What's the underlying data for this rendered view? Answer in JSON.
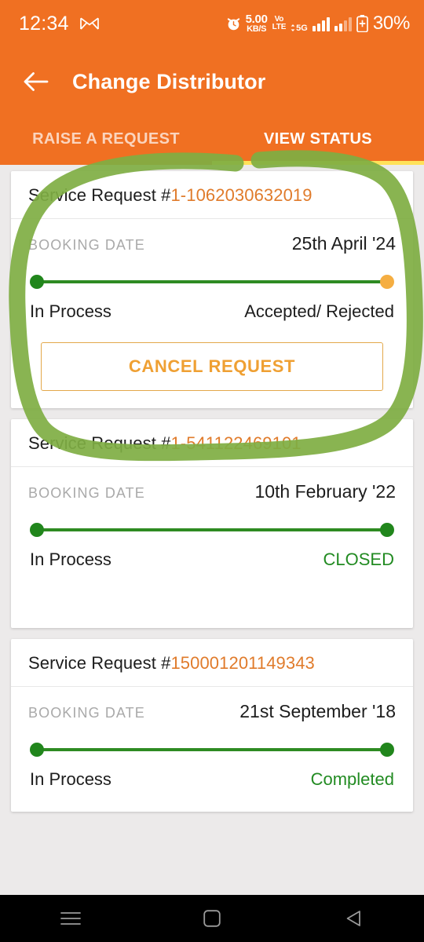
{
  "status_bar": {
    "time": "12:34",
    "gmail_icon": "gmail-icon",
    "alarm_icon": "alarm-icon",
    "net_speed_value": "5.00",
    "net_speed_unit": "KB/S",
    "volte_line1": "Vo",
    "volte_line2": "LTE",
    "network_type": "5G",
    "battery_percent": "30%"
  },
  "app_bar": {
    "back_icon": "back-arrow-icon",
    "title": "Change Distributor"
  },
  "tabs": {
    "items": [
      {
        "label": "RAISE A REQUEST",
        "active": false
      },
      {
        "label": "VIEW STATUS",
        "active": true
      }
    ],
    "indicator_color": "#FFE25A"
  },
  "annotation": {
    "type": "hand-drawn-circle",
    "color": "#7FAE43",
    "target": "first service request card"
  },
  "labels": {
    "service_request_prefix": "Service Request #",
    "booking_date": "BOOKING DATE",
    "stage_start": "In Process",
    "cancel_request": "CANCEL REQUEST"
  },
  "colors": {
    "brand_orange": "#F07022",
    "request_number": "#E07B2B",
    "progress_done": "#21861C",
    "progress_pending": "#F5AE42",
    "status_green": "#228B22",
    "cancel_border": "#E3A84B",
    "cancel_text": "#EFA033"
  },
  "requests": [
    {
      "number": "1-1062030632019",
      "booking_date_label": "BOOKING DATE",
      "booking_date": "25th April '24",
      "stage_start": "In Process",
      "stage_end": "Accepted/ Rejected",
      "start_dot": "green",
      "end_dot": "amber",
      "end_status_green": false,
      "has_cancel_button": true,
      "cancel_label": "CANCEL REQUEST"
    },
    {
      "number": "1-541122469101",
      "booking_date_label": "BOOKING DATE",
      "booking_date": "10th February '22",
      "stage_start": "In Process",
      "stage_end": "CLOSED",
      "start_dot": "green",
      "end_dot": "green",
      "end_status_green": true,
      "has_cancel_button": false,
      "cancel_label": ""
    },
    {
      "number": "150001201149343",
      "booking_date_label": "BOOKING DATE",
      "booking_date": "21st September '18",
      "stage_start": "In Process",
      "stage_end": "Completed",
      "start_dot": "green",
      "end_dot": "green",
      "end_status_green": true,
      "has_cancel_button": false,
      "cancel_label": ""
    }
  ],
  "nav_bar": {
    "recents_icon": "recents-menu-icon",
    "home_icon": "home-square-icon",
    "back_icon": "back-triangle-icon"
  }
}
